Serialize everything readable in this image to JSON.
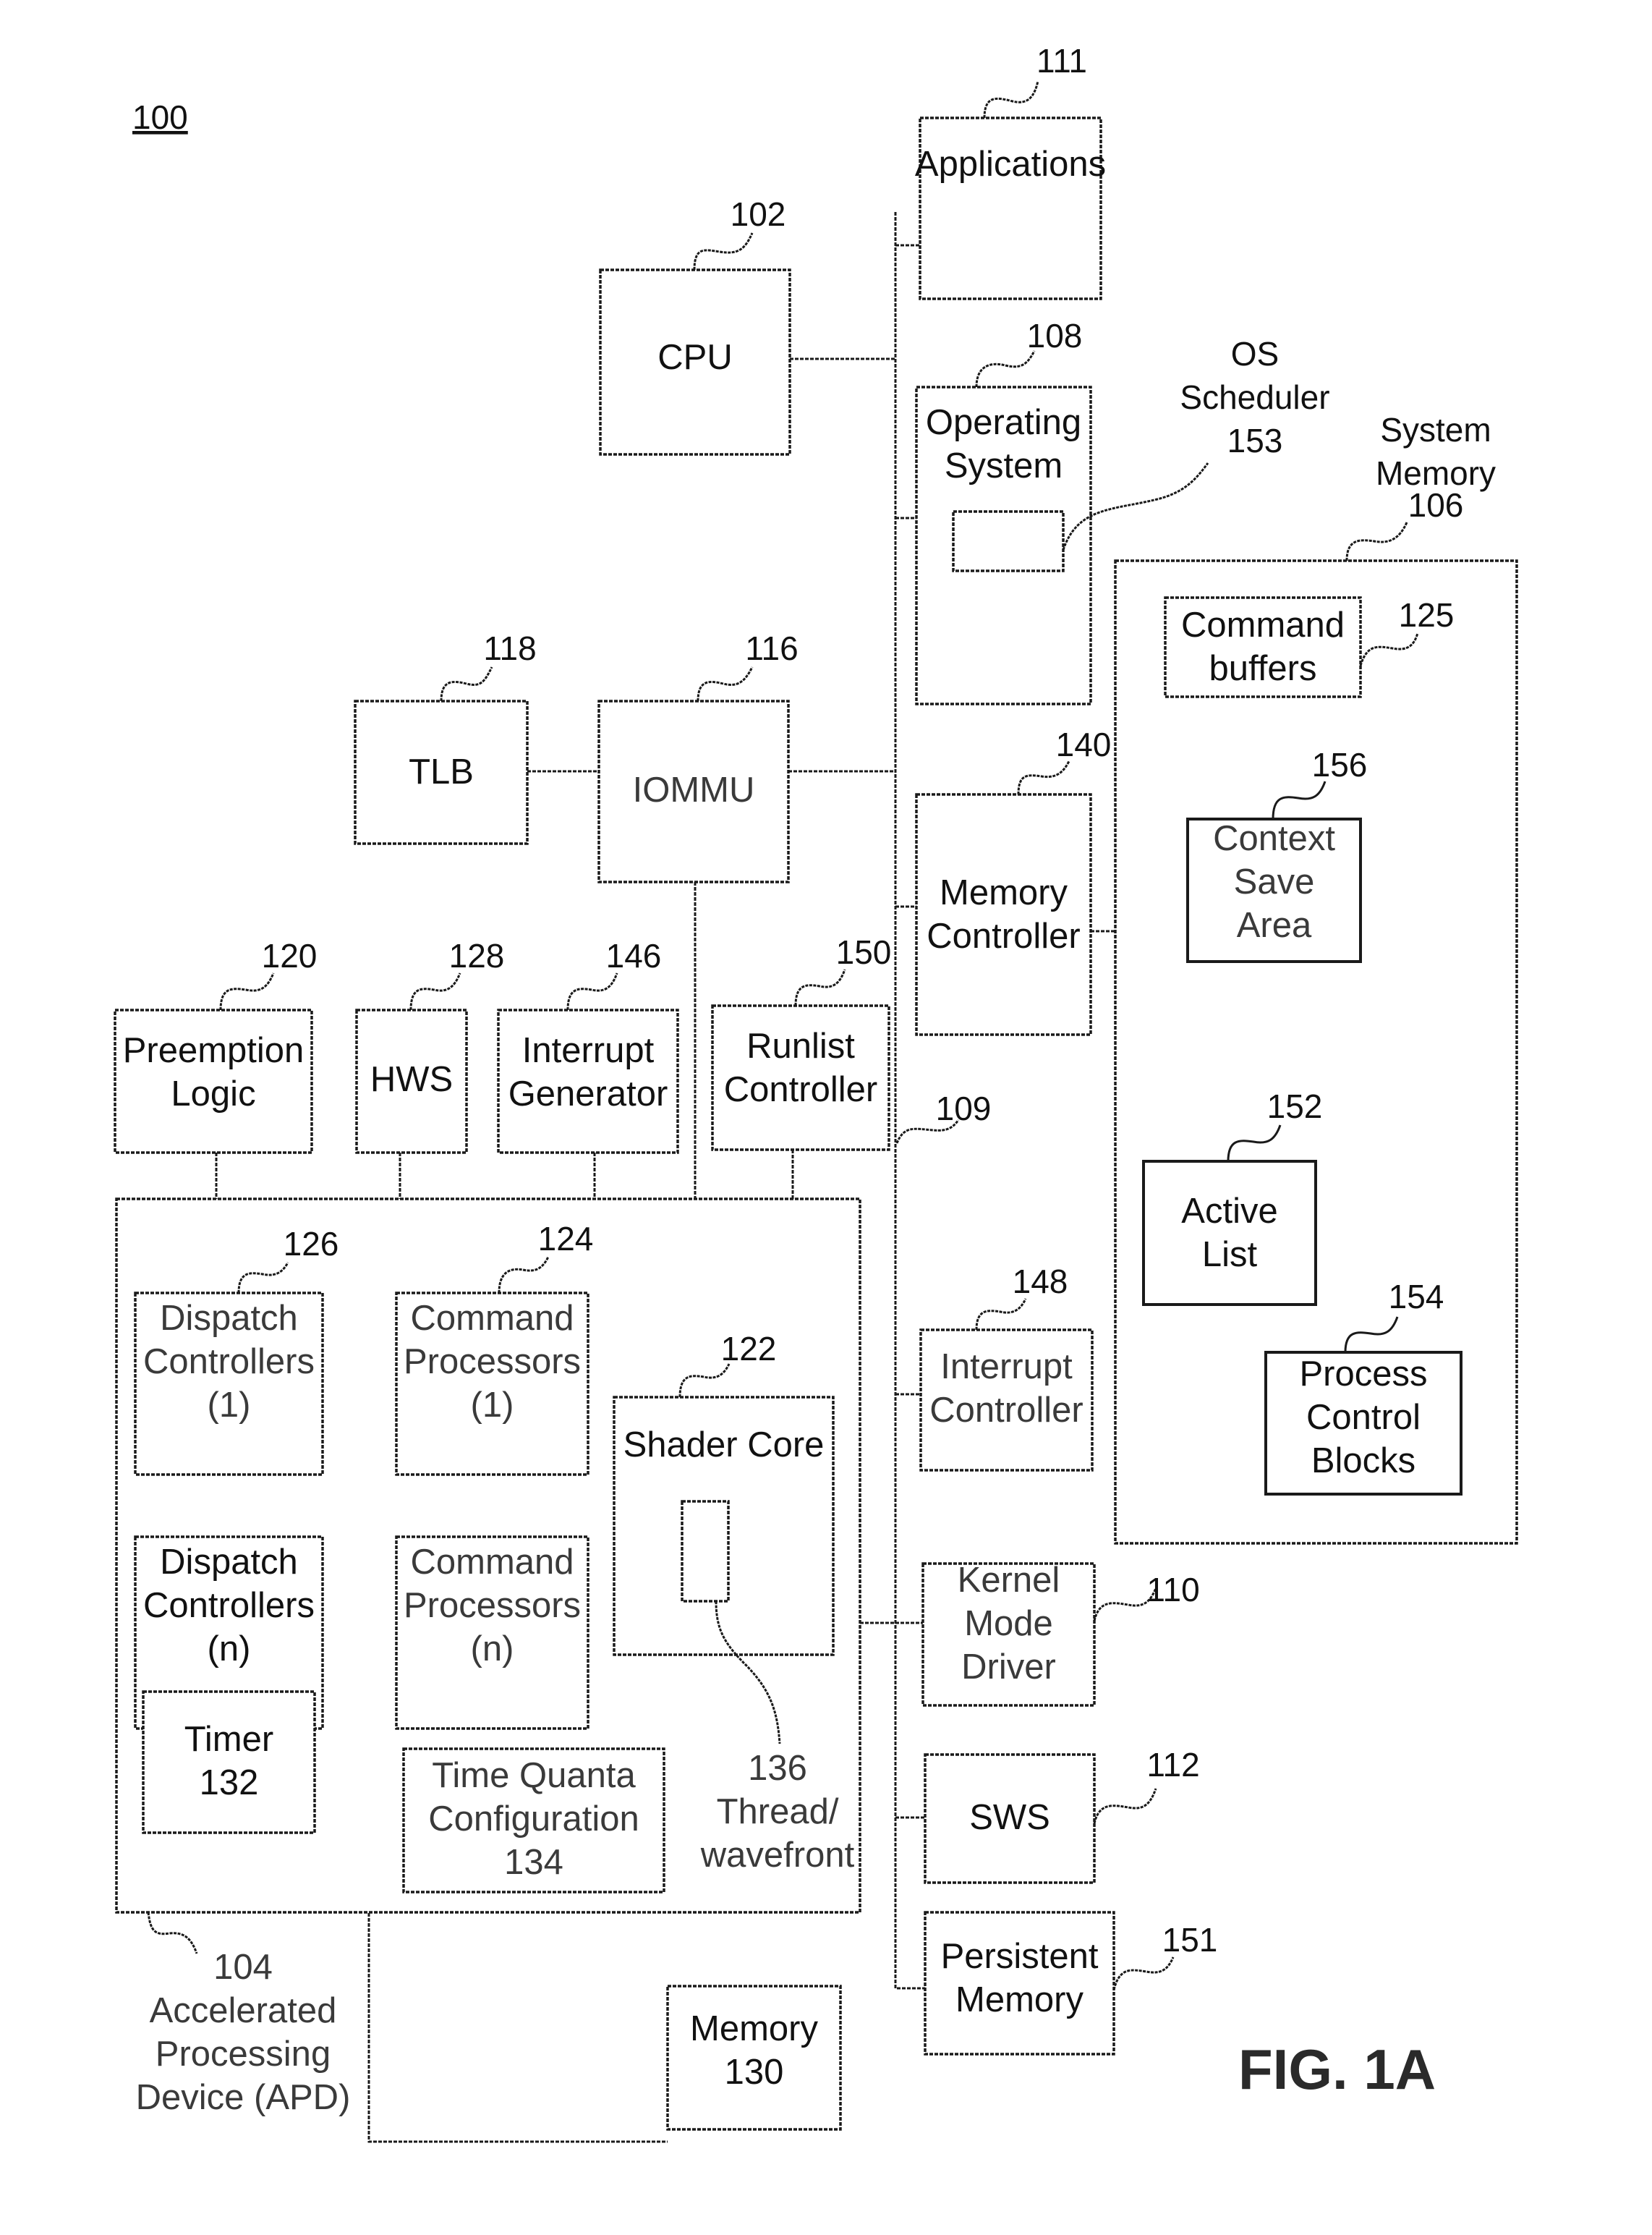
{
  "figure": {
    "system_ref": "100",
    "caption": "FIG. 1A"
  },
  "blocks": {
    "cpu": {
      "ref": "102",
      "lines": [
        "CPU"
      ]
    },
    "applications": {
      "ref": "111",
      "lines": [
        "Applications"
      ]
    },
    "operating_system": {
      "ref": "108",
      "lines": [
        "Operating",
        "System"
      ]
    },
    "os_scheduler": {
      "ref": "153",
      "lines": [
        "OS",
        "Scheduler",
        "153"
      ]
    },
    "system_memory": {
      "ref": "106",
      "lines": [
        "System",
        "Memory",
        "106"
      ]
    },
    "command_buffers": {
      "ref": "125",
      "lines": [
        "Command",
        "buffers"
      ]
    },
    "context_save_area": {
      "ref": "156",
      "lines": [
        "Context",
        "Save",
        "Area"
      ]
    },
    "active_list": {
      "ref": "152",
      "lines": [
        "Active",
        "List"
      ]
    },
    "process_control_blocks": {
      "ref": "154",
      "lines": [
        "Process",
        "Control",
        "Blocks"
      ]
    },
    "tlb": {
      "ref": "118",
      "lines": [
        "TLB"
      ]
    },
    "iommu": {
      "ref": "116",
      "lines": [
        "IOMMU"
      ]
    },
    "memory_controller": {
      "ref": "140",
      "lines": [
        "Memory",
        "Controller"
      ]
    },
    "preemption_logic": {
      "ref": "120",
      "lines": [
        "Preemption",
        "Logic"
      ]
    },
    "hws": {
      "ref": "128",
      "lines": [
        "HWS"
      ]
    },
    "interrupt_generator": {
      "ref": "146",
      "lines": [
        "Interrupt",
        "Generator"
      ]
    },
    "runlist_controller": {
      "ref": "150",
      "lines": [
        "Runlist",
        "Controller"
      ]
    },
    "bus": {
      "ref": "109"
    },
    "apd": {
      "ref": "104",
      "lines": [
        "104",
        "Accelerated",
        "Processing",
        "Device (APD)"
      ]
    },
    "dispatch_controllers_1": {
      "ref": "126",
      "lines": [
        "Dispatch",
        "Controllers",
        "(1)"
      ]
    },
    "dispatch_controllers_n": {
      "lines": [
        "Dispatch",
        "Controllers",
        "(n)"
      ]
    },
    "command_processors_1": {
      "ref": "124",
      "lines": [
        "Command",
        "Processors",
        "(1)"
      ]
    },
    "command_processors_n": {
      "lines": [
        "Command",
        "Processors",
        "(n)"
      ]
    },
    "shader_core": {
      "ref": "122",
      "lines": [
        "Shader Core"
      ]
    },
    "thread_wavefront": {
      "ref": "136",
      "lines": [
        "136",
        "Thread/",
        "wavefront"
      ]
    },
    "timer": {
      "lines": [
        "Timer",
        "132"
      ]
    },
    "time_quanta_configuration": {
      "lines": [
        "Time Quanta",
        "Configuration",
        "134"
      ]
    },
    "memory_130": {
      "lines": [
        "Memory",
        "130"
      ]
    },
    "interrupt_controller": {
      "ref": "148",
      "lines": [
        "Interrupt",
        "Controller"
      ]
    },
    "kernel_mode_driver": {
      "ref": "110",
      "lines": [
        "Kernel",
        "Mode",
        "Driver"
      ]
    },
    "sws": {
      "ref": "112",
      "lines": [
        "SWS"
      ]
    },
    "persistent_memory": {
      "ref": "151",
      "lines": [
        "Persistent",
        "Memory"
      ]
    }
  }
}
